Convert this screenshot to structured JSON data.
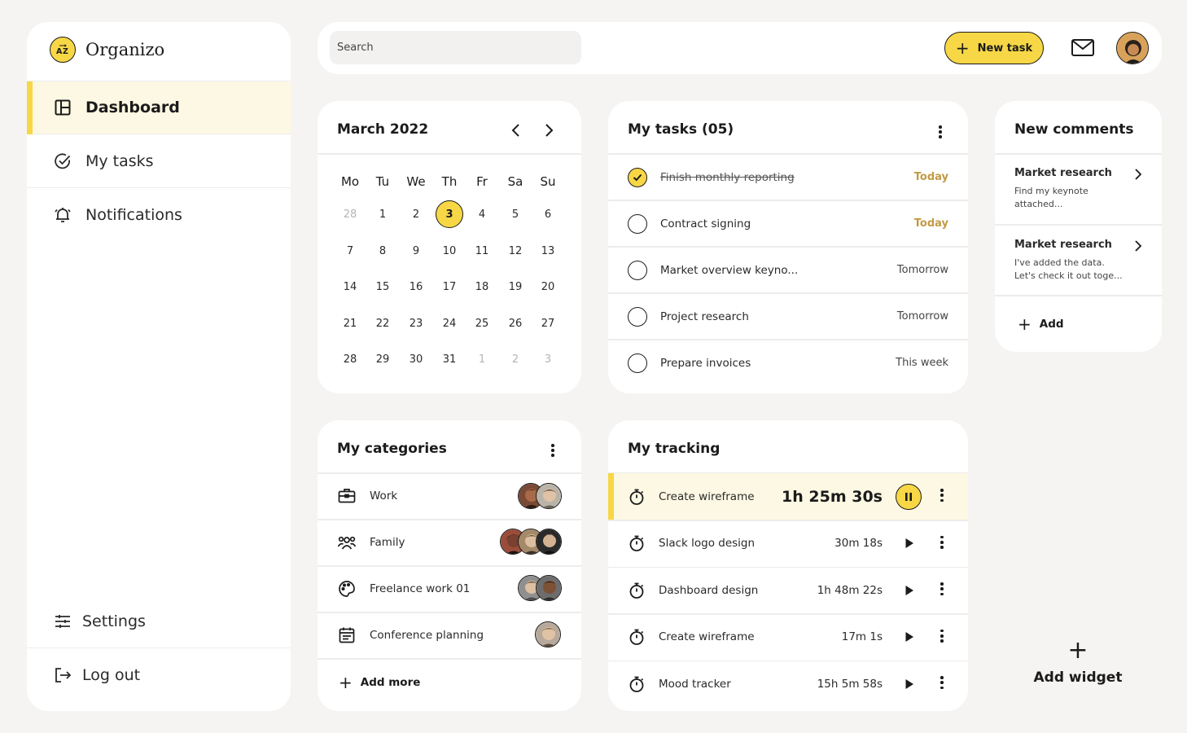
{
  "app": {
    "name": "Organizo",
    "logo_glyph": "A Z"
  },
  "sidebar": {
    "items": [
      {
        "label": "Dashboard",
        "icon": "dashboard-icon",
        "active": true
      },
      {
        "label": "My tasks",
        "icon": "check-circle-icon",
        "active": false
      },
      {
        "label": "Notifications",
        "icon": "bell-icon",
        "active": false
      }
    ],
    "bottom": [
      {
        "label": "Settings",
        "icon": "sliders-icon"
      },
      {
        "label": "Log out",
        "icon": "logout-icon"
      }
    ]
  },
  "topbar": {
    "search_placeholder": "Search",
    "new_task_label": "New task",
    "mail_icon": "mail-icon",
    "avatar_icon": "user-avatar"
  },
  "calendar": {
    "title": "March 2022",
    "weekdays": [
      "Mo",
      "Tu",
      "We",
      "Th",
      "Fr",
      "Sa",
      "Su"
    ],
    "weeks": [
      [
        "28",
        "1",
        "2",
        "3",
        "4",
        "5",
        "6"
      ],
      [
        "7",
        "8",
        "9",
        "10",
        "11",
        "12",
        "13"
      ],
      [
        "14",
        "15",
        "16",
        "17",
        "18",
        "19",
        "20"
      ],
      [
        "21",
        "22",
        "23",
        "24",
        "25",
        "26",
        "27"
      ],
      [
        "28",
        "29",
        "30",
        "31",
        "1",
        "2",
        "3"
      ]
    ],
    "today": "3"
  },
  "tasks": {
    "title": "My tasks (05)",
    "items": [
      {
        "name": "Finish monthly reporting",
        "due": "Today",
        "done": true
      },
      {
        "name": "Contract signing",
        "due": "Today",
        "done": false
      },
      {
        "name": "Market overview keyno...",
        "due": "Tomorrow",
        "done": false
      },
      {
        "name": "Project research",
        "due": "Tomorrow",
        "done": false
      },
      {
        "name": "Prepare invoices",
        "due": "This week",
        "done": false
      }
    ]
  },
  "comments": {
    "title": "New comments",
    "items": [
      {
        "title": "Market research",
        "line1": "Find my keynote",
        "line2": "attached..."
      },
      {
        "title": "Market research",
        "line1": "I've added the data.",
        "line2": "Let's check it out toge..."
      }
    ],
    "add_label": "Add"
  },
  "categories": {
    "title": "My categories",
    "items": [
      {
        "name": "Work",
        "icon": "briefcase-icon",
        "members": 2
      },
      {
        "name": "Family",
        "icon": "family-icon",
        "members": 3
      },
      {
        "name": "Freelance work 01",
        "icon": "palette-icon",
        "members": 2
      },
      {
        "name": "Conference planning",
        "icon": "calendar-icon",
        "members": 1
      }
    ],
    "add_label": "Add more"
  },
  "tracking": {
    "title": "My tracking",
    "items": [
      {
        "name": "Create wireframe",
        "time": "1h 25m 30s",
        "running": true
      },
      {
        "name": "Slack logo design",
        "time": "30m 18s",
        "running": false
      },
      {
        "name": "Dashboard design",
        "time": "1h 48m 22s",
        "running": false
      },
      {
        "name": "Create wireframe",
        "time": "17m 1s",
        "running": false
      },
      {
        "name": "Mood tracker",
        "time": "15h 5m 58s",
        "running": false
      }
    ]
  },
  "widget": {
    "add_label": "Add widget"
  },
  "colors": {
    "accent": "#f7d746",
    "accent_soft": "#fdf8e3",
    "due_today": "#c29a45",
    "background": "#f5f4f2"
  }
}
